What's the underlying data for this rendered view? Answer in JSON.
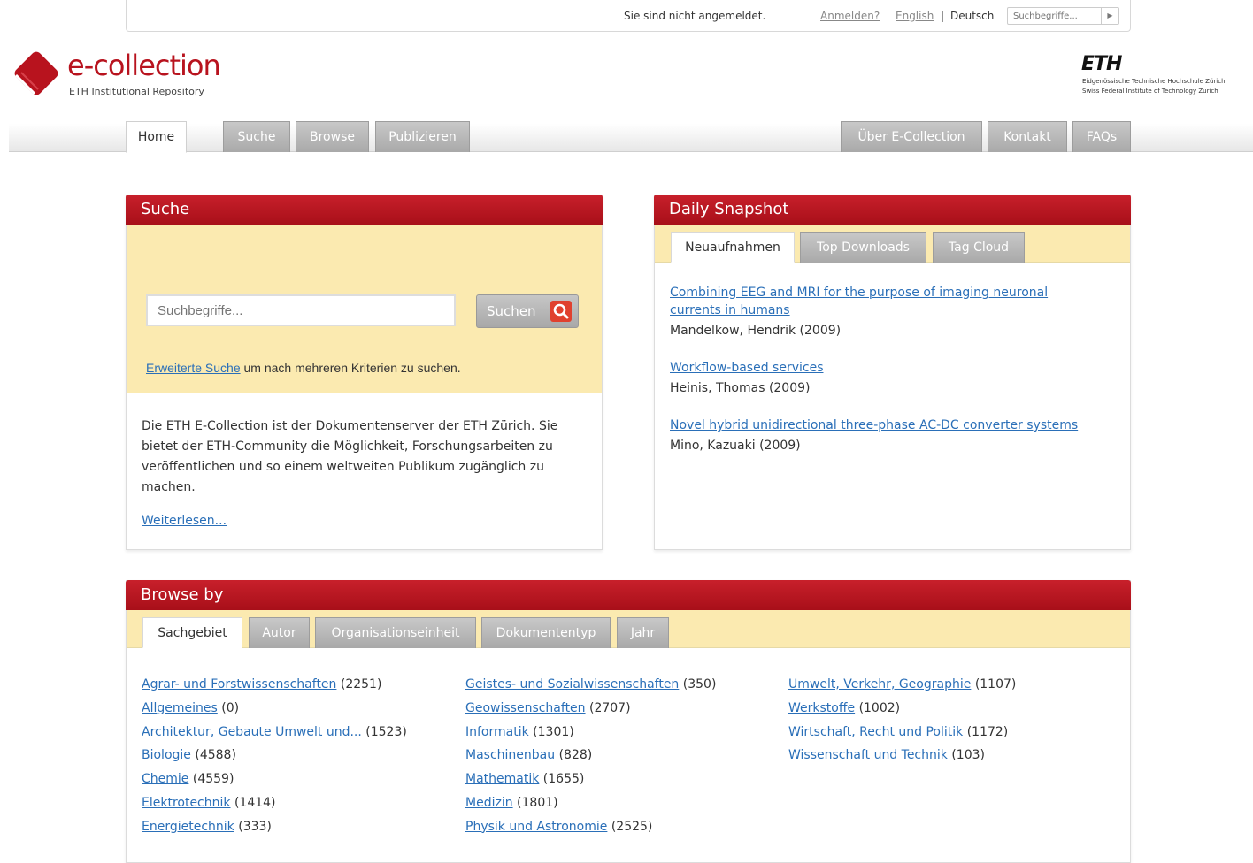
{
  "topbar": {
    "status": "Sie sind nicht angemeldet.",
    "login": "Anmelden?",
    "lang_en": "English",
    "separator": "|",
    "lang_de": "Deutsch",
    "search_placeholder": "Suchbegriffe...",
    "go_icon": "triangle-right-icon"
  },
  "brand": {
    "title": "e-collection",
    "subtitle": "ETH Institutional Repository",
    "eth_logo": "ETH",
    "eth_line1": "Eidgenössische Technische Hochschule Zürich",
    "eth_line2": "Swiss Federal Institute of Technology Zurich",
    "accent": "#b8131e"
  },
  "nav": {
    "left": [
      {
        "label": "Home",
        "active": true
      },
      {
        "label": "Suche"
      },
      {
        "label": "Browse"
      },
      {
        "label": "Publizieren"
      }
    ],
    "right": [
      {
        "label": "Über E-Collection"
      },
      {
        "label": "Kontakt"
      },
      {
        "label": "FAQs"
      }
    ]
  },
  "search_panel": {
    "title": "Suche",
    "placeholder": "Suchbegriffe...",
    "button": "Suchen",
    "advanced_link": "Erweiterte Suche",
    "advanced_text": " um nach mehreren Kriterien zu suchen.",
    "about": "Die ETH E-Collection ist der Dokumentenserver der ETH Zürich. Sie bietet der ETH-Community die Möglichkeit, Forschungsarbeiten zu veröffentlichen und so einem weltweiten Publikum zugänglich zu machen.",
    "more": "Weiterlesen..."
  },
  "snapshot": {
    "title": "Daily Snapshot",
    "tabs": [
      "Neuaufnahmen",
      "Top Downloads",
      "Tag Cloud"
    ],
    "items": [
      {
        "title": "Combining EEG and MRI for the purpose of imaging neuronal currents in humans",
        "author": "Mandelkow, Hendrik (2009)"
      },
      {
        "title": "Workflow-based services",
        "author": "Heinis, Thomas (2009)"
      },
      {
        "title": "Novel hybrid unidirectional three-phase AC-DC converter systems",
        "author": "Mino, Kazuaki (2009)"
      }
    ]
  },
  "browse": {
    "title": "Browse by",
    "tabs": [
      "Sachgebiet",
      "Autor",
      "Organisationseinheit",
      "Dokumententyp",
      "Jahr"
    ],
    "col1": [
      {
        "label": "Agrar- und Forstwissenschaften",
        "count": "(2251)"
      },
      {
        "label": "Allgemeines",
        "count": "(0)"
      },
      {
        "label": "Architektur, Gebaute Umwelt und...",
        "count": "(1523)"
      },
      {
        "label": "Biologie",
        "count": "(4588)"
      },
      {
        "label": "Chemie",
        "count": "(4559)"
      },
      {
        "label": "Elektrotechnik",
        "count": "(1414)"
      },
      {
        "label": "Energietechnik",
        "count": "(333)"
      }
    ],
    "col2": [
      {
        "label": "Geistes- und Sozialwissenschaften",
        "count": "(350)"
      },
      {
        "label": "Geowissenschaften",
        "count": "(2707)"
      },
      {
        "label": "Informatik",
        "count": "(1301)"
      },
      {
        "label": "Maschinenbau",
        "count": "(828)"
      },
      {
        "label": "Mathematik",
        "count": "(1655)"
      },
      {
        "label": "Medizin",
        "count": "(1801)"
      },
      {
        "label": "Physik und Astronomie",
        "count": "(2525)"
      }
    ],
    "col3": [
      {
        "label": "Umwelt, Verkehr, Geographie",
        "count": "(1107)"
      },
      {
        "label": "Werkstoffe",
        "count": "(1002)"
      },
      {
        "label": "Wirtschaft, Recht und Politik",
        "count": "(1172)"
      },
      {
        "label": "Wissenschaft und Technik",
        "count": "(103)"
      }
    ]
  }
}
